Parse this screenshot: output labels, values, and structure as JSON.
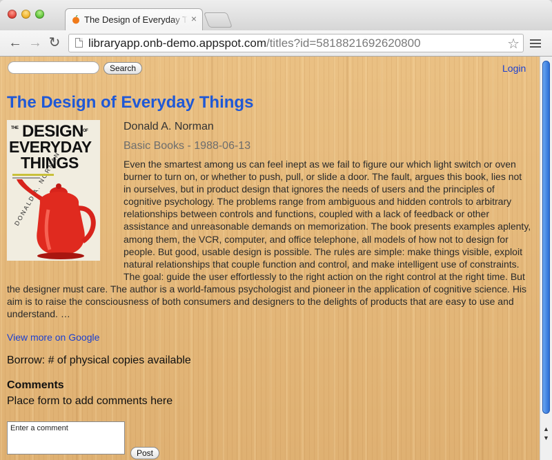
{
  "browser": {
    "tab_title": "The Design of Everyday Things",
    "tab_close": "×",
    "url_host": "libraryapp.onb-demo.appspot.com",
    "url_path": "/titles?id=5818821692620800",
    "back_icon": "←",
    "forward_icon": "→",
    "reload_icon": "↻",
    "star_icon": "☆"
  },
  "header": {
    "search_placeholder": "",
    "search_button": "Search",
    "login": "Login"
  },
  "book": {
    "title": "The Design of Everyday Things",
    "author": "Donald A. Norman",
    "publisher_date": "Basic Books - 1988-06-13",
    "description": "Even the smartest among us can feel inept as we fail to figure our which light switch or oven burner to turn on, or whether to push, pull, or slide a door. The fault, argues this book, lies not in ourselves, but in product design that ignores the needs of users and the principles of cognitive psychology. The problems range from ambiguous and hidden controls to arbitrary relationships between controls and functions, coupled with a lack of feedback or other assistance and unreasonable demands on memorization. The book presents examples aplenty, among them, the VCR, computer, and office telephone, all models of how not to design for people. But good, usable design is possible. The rules are simple: make things visible, exploit natural relationships that couple function and control, and make intelligent use of constraints. The goal: guide the user effortlessly to the right action on the right control at the right time. But the designer must care. The author is a world-famous psychologist and pioneer in the application of cognitive science. His aim is to raise the consciousness of both consumers and designers to the delights of products that are easy to use and understand. …",
    "cover": {
      "line1": "DESIGN",
      "line2": "EVERYDAY",
      "line3": "THINGS",
      "the": "THE",
      "of": "OF",
      "author": "DONALD A. NORMAN"
    }
  },
  "links": {
    "google": "View more on Google"
  },
  "borrow": {
    "text": "Borrow: # of physical copies available"
  },
  "comments": {
    "heading": "Comments",
    "note": "Place form to add comments here",
    "placeholder": "Enter a comment",
    "post_button": "Post"
  },
  "colors": {
    "link": "#1a3fd0",
    "title": "#1f58d6",
    "wood": "#e3b77a"
  }
}
